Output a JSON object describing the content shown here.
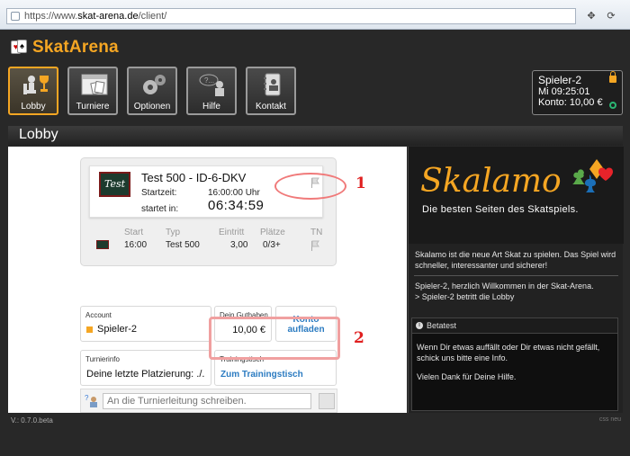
{
  "browser": {
    "url_prefix": "https://www.",
    "url_host": "skat-arena.de",
    "url_path": "/client/"
  },
  "app": {
    "name": "SkatArena",
    "accent": "#f5a623"
  },
  "nav": [
    {
      "label": "Lobby",
      "icon": "lobby-icon",
      "active": true
    },
    {
      "label": "Turniere",
      "icon": "tournament-calendar-icon"
    },
    {
      "label": "Optionen",
      "icon": "gears-icon"
    },
    {
      "label": "Hilfe",
      "icon": "help-chat-icon"
    },
    {
      "label": "Kontakt",
      "icon": "address-book-icon"
    }
  ],
  "account": {
    "name": "Spieler-2",
    "time": "Mi 09:25:01",
    "balance": "Konto: 10,00 €"
  },
  "page": {
    "title": "Lobby"
  },
  "tournament": {
    "badge": "Test",
    "title": "Test 500 - ID-6-DKV",
    "start_label": "Startzeit:",
    "start_value": "16:00:00 Uhr",
    "countdown_label": "startet in:",
    "countdown_value": "06:34:59",
    "table": {
      "headers": [
        "Start",
        "Typ",
        "Eintritt",
        "Plätze",
        "TN"
      ],
      "row": {
        "badge": "Test",
        "start": "16:00",
        "typ": "Test 500",
        "eintritt": "3,00",
        "plaetze": "0/3+"
      }
    }
  },
  "account_box": {
    "caption": "Account",
    "value": "Spieler-2"
  },
  "balance_box": {
    "caption": "Dein Guthaben",
    "value": "10,00 €"
  },
  "topup": {
    "line1": "Konto",
    "line2": "aufladen"
  },
  "turnierinfo": {
    "caption": "Turnierinfo",
    "value": "Deine letzte Platzierung: ./."
  },
  "training": {
    "caption": "Trainingstisch",
    "link": "Zum Trainingstisch"
  },
  "chat": {
    "placeholder": "An die Turnierleitung schreiben."
  },
  "annotations": {
    "one": "1",
    "two": "2"
  },
  "side": {
    "logo": "Skalamo",
    "tagline": "Die besten Seiten des Skatspiels.",
    "intro": "Skalamo ist die neue Art Skat zu spielen. Das Spiel wird schneller, interessanter und sicherer!",
    "welcome": "Spieler-2, herzlich Willkommen in der Skat-Arena.",
    "entered": "> Spieler-2 betritt die Lobby",
    "beta_title": "Betatest",
    "beta_p1": "Wenn Dir etwas auffällt oder Dir etwas nicht gefällt, schick uns bitte eine Info.",
    "beta_p2": "Vielen Dank für Deine Hilfe."
  },
  "footer": {
    "version": "V.: 0.7.0.beta",
    "right": "css neu"
  }
}
